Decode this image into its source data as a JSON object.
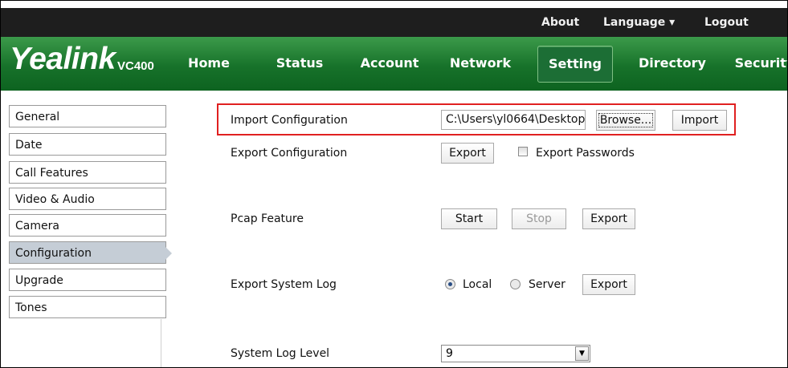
{
  "topbar": {
    "about": "About",
    "language": "Language ▾",
    "logout": "Logout"
  },
  "logo": {
    "brand": "Yealink",
    "model": "VC400"
  },
  "nav": [
    "Home",
    "Status",
    "Account",
    "Network",
    "Setting",
    "Directory",
    "Security"
  ],
  "nav_active": "Setting",
  "sidebar": {
    "items": [
      "General",
      "Date",
      "Call Features",
      "Video & Audio",
      "Camera",
      "Configuration",
      "Upgrade",
      "Tones"
    ],
    "active": "Configuration"
  },
  "import": {
    "label": "Import Configuration",
    "file_value": "C:\\Users\\yl0664\\Desktop",
    "browse": "Browse...",
    "import": "Import"
  },
  "export_cfg": {
    "label": "Export Configuration",
    "export": "Export",
    "checkbox_label": "Export Passwords",
    "checked": false
  },
  "pcap": {
    "label": "Pcap Feature",
    "start": "Start",
    "stop": "Stop",
    "export": "Export"
  },
  "syslog": {
    "label": "Export System Log",
    "local": "Local",
    "server": "Server",
    "selected": "Local",
    "export": "Export"
  },
  "loglevel": {
    "label": "System Log Level",
    "value": "9"
  },
  "colors": {
    "nav_green": "#17722a",
    "topbar": "#1e1e1e",
    "highlight": "#e02020",
    "active_side": "#c5cdd6"
  }
}
